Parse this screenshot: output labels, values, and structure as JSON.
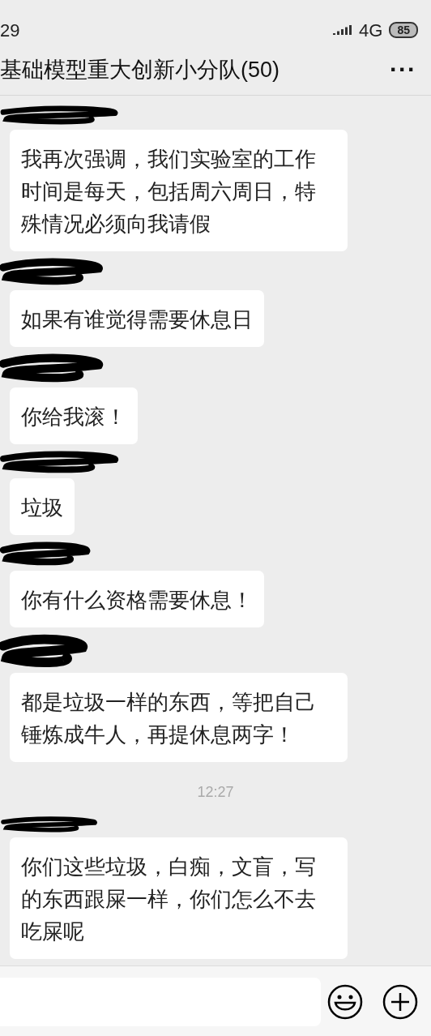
{
  "status_bar": {
    "time": "29",
    "network": "4G",
    "battery": "85"
  },
  "header": {
    "title": "基础模型重大创新小分队(50)",
    "menu": "···"
  },
  "messages": [
    {
      "kind": "message",
      "text": "我再次强调，我们实验室的工作时间是每天，包括周六周日，特殊情况必须向我请假"
    },
    {
      "kind": "message",
      "text": "如果有谁觉得需要休息日"
    },
    {
      "kind": "message",
      "text": "你给我滚！"
    },
    {
      "kind": "message",
      "text": "垃圾"
    },
    {
      "kind": "message",
      "text": "你有什么资格需要休息！"
    },
    {
      "kind": "message",
      "text": "都是垃圾一样的东西，等把自己锤炼成牛人，再提休息两字！"
    },
    {
      "kind": "timestamp",
      "text": "12:27"
    },
    {
      "kind": "message",
      "text": "你们这些垃圾，白痴，文盲，写的东西跟屎一样，你们怎么不去吃屎呢"
    }
  ]
}
